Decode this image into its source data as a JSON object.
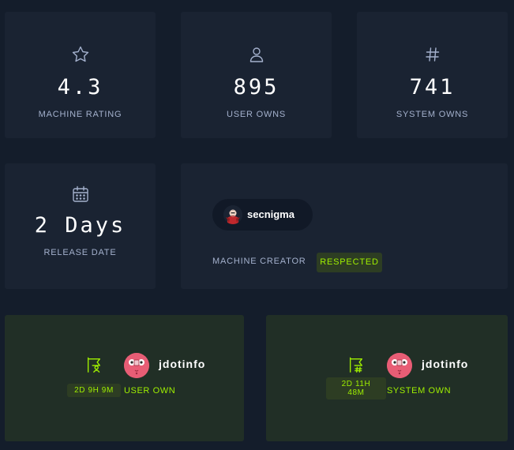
{
  "stats": [
    {
      "icon": "star-icon",
      "value": "4.3",
      "label": "MACHINE RATING"
    },
    {
      "icon": "user-icon",
      "value": "895",
      "label": "USER OWNS"
    },
    {
      "icon": "hash-icon",
      "value": "741",
      "label": "SYSTEM OWNS"
    }
  ],
  "release": {
    "icon": "calendar-icon",
    "value": "2 Days",
    "label": "RELEASE DATE"
  },
  "creator": {
    "name": "secnigma",
    "label": "MACHINE CREATOR",
    "badge": "RESPECTED"
  },
  "bloods": [
    {
      "icon": "user-flag-icon",
      "user": "jdotinfo",
      "time": "2D 9H 9M",
      "label": "USER OWN"
    },
    {
      "icon": "system-flag-icon",
      "user": "jdotinfo",
      "time": "2D 11H 48M",
      "label": "SYSTEM OWN"
    }
  ],
  "colors": {
    "background": "#141d2b",
    "card": "#1a2332",
    "blood_card": "#212f26",
    "accent_green": "#9fef00",
    "label_gray": "#a4b1cd",
    "avatar_pink": "#e85d75"
  }
}
